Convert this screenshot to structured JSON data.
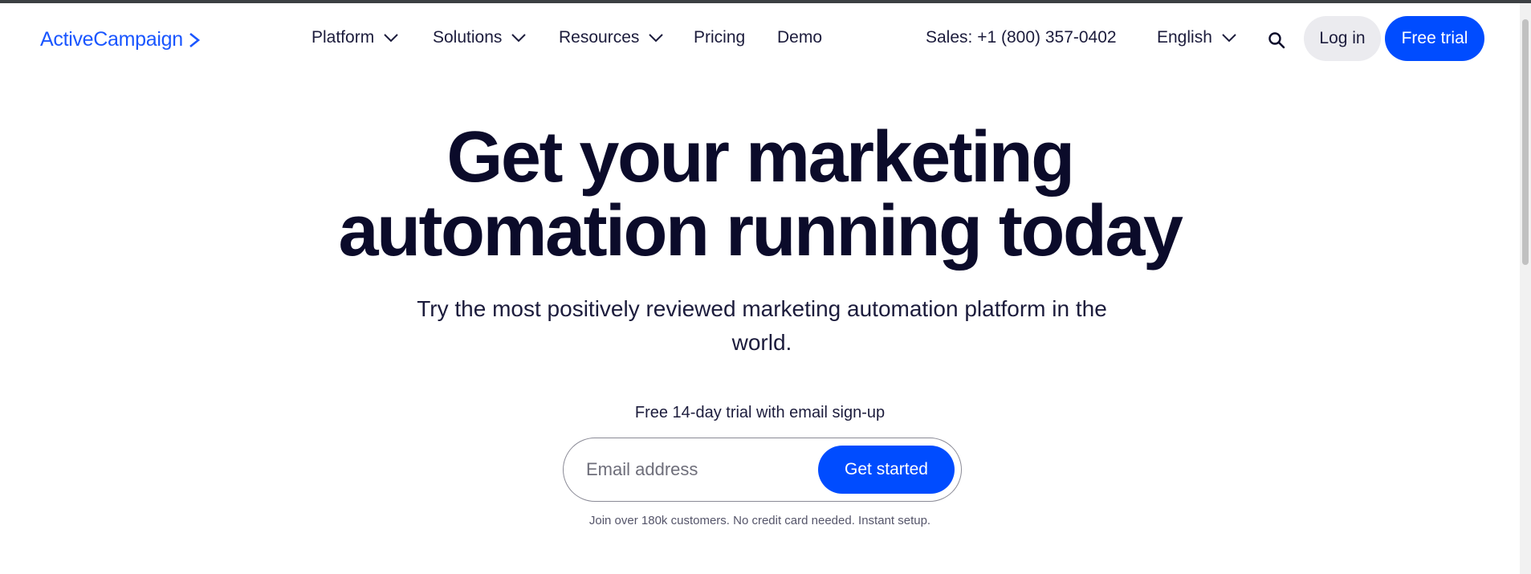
{
  "nav": {
    "logo": "ActiveCampaign",
    "items": [
      {
        "label": "Platform",
        "has_dropdown": true
      },
      {
        "label": "Solutions",
        "has_dropdown": true
      },
      {
        "label": "Resources",
        "has_dropdown": true
      },
      {
        "label": "Pricing",
        "has_dropdown": false
      },
      {
        "label": "Demo",
        "has_dropdown": false
      }
    ],
    "sales": "Sales: +1 (800) 357-0402",
    "language": "English",
    "search_icon": "search-icon",
    "login_label": "Log in",
    "trial_label": "Free trial"
  },
  "hero": {
    "title_line1": "Get your marketing",
    "title_line2": "automation running today",
    "subtitle": "Try the most positively reviewed marketing automation platform in the world.",
    "trial_note": "Free 14-day trial with email sign-up",
    "email_placeholder": "Email address",
    "email_value": "",
    "cta_label": "Get started",
    "fineprint": "Join over 180k customers. No credit card needed. Instant setup."
  },
  "colors": {
    "brand_blue": "#004cff",
    "logo_blue": "#1a56ff",
    "heading": "#0b0b2a",
    "login_bg": "#ebebef"
  }
}
